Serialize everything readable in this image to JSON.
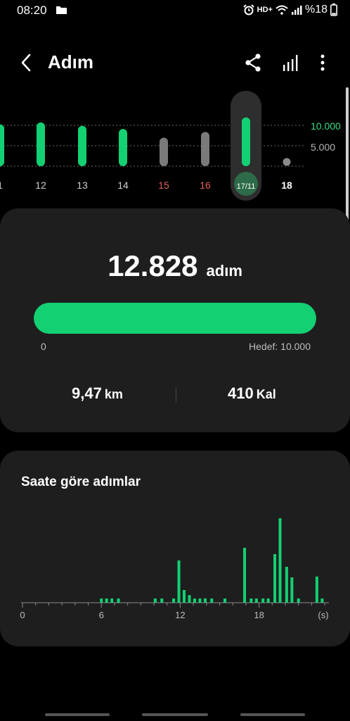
{
  "status_bar": {
    "time": "08:20",
    "network": "HD+",
    "battery": "%18",
    "icons": [
      "folder-icon",
      "alarm-icon",
      "wifi-icon",
      "signal-icon"
    ]
  },
  "app_bar": {
    "title": "Adım",
    "icons": [
      "back-arrow-icon",
      "share-icon",
      "trend-bars-icon",
      "more-vert-icon"
    ]
  },
  "daily_chart": {
    "goal_10k_label": "10.000",
    "goal_5k_label": "5.000",
    "days": [
      {
        "label": "1",
        "steps": 11000,
        "weekend": false,
        "met_goal": true
      },
      {
        "label": "12",
        "steps": 11500,
        "weekend": false,
        "met_goal": true
      },
      {
        "label": "13",
        "steps": 10600,
        "weekend": false,
        "met_goal": true
      },
      {
        "label": "14",
        "steps": 9800,
        "weekend": false,
        "met_goal": true
      },
      {
        "label": "15",
        "steps": 7500,
        "weekend": true,
        "met_goal": false
      },
      {
        "label": "16",
        "steps": 9000,
        "weekend": true,
        "met_goal": false
      },
      {
        "label": "17/11",
        "steps": 12828,
        "weekend": false,
        "met_goal": true,
        "selected": true
      },
      {
        "label": "18",
        "steps": 0,
        "weekend": false,
        "met_goal": false,
        "today": true
      }
    ],
    "colors": {
      "goal": "#13d073",
      "below_goal": "#7a7a7a",
      "weekend_label": "#e0635b"
    }
  },
  "summary": {
    "steps_value": "12.828",
    "steps_unit": "adım",
    "progress_fraction": 1.0,
    "progress_min_label": "0",
    "progress_goal_label": "Hedef: 10.000",
    "distance_value": "9,47",
    "distance_unit": "km",
    "calories_value": "410",
    "calories_unit": "Kal"
  },
  "hourly": {
    "title": "Saate göre adımlar",
    "x_ticks": [
      "0",
      "6",
      "12",
      "18"
    ],
    "unit": "(s)",
    "max_steps": 2000,
    "bars": [
      {
        "hour": 6,
        "steps": 100
      },
      {
        "hour": 6.4,
        "steps": 100
      },
      {
        "hour": 6.8,
        "steps": 100
      },
      {
        "hour": 7.3,
        "steps": 100
      },
      {
        "hour": 10.1,
        "steps": 100
      },
      {
        "hour": 10.6,
        "steps": 100
      },
      {
        "hour": 11.5,
        "steps": 100
      },
      {
        "hour": 11.9,
        "steps": 1000
      },
      {
        "hour": 12.3,
        "steps": 300
      },
      {
        "hour": 12.7,
        "steps": 180
      },
      {
        "hour": 13.1,
        "steps": 100
      },
      {
        "hour": 13.5,
        "steps": 100
      },
      {
        "hour": 13.9,
        "steps": 100
      },
      {
        "hour": 14.4,
        "steps": 100
      },
      {
        "hour": 15.4,
        "steps": 100
      },
      {
        "hour": 16.9,
        "steps": 1300
      },
      {
        "hour": 17.4,
        "steps": 100
      },
      {
        "hour": 17.8,
        "steps": 100
      },
      {
        "hour": 18.3,
        "steps": 100
      },
      {
        "hour": 18.7,
        "steps": 100
      },
      {
        "hour": 19.2,
        "steps": 1150
      },
      {
        "hour": 19.6,
        "steps": 2000
      },
      {
        "hour": 20.1,
        "steps": 850
      },
      {
        "hour": 20.5,
        "steps": 600
      },
      {
        "hour": 21,
        "steps": 100
      },
      {
        "hour": 22.4,
        "steps": 620
      },
      {
        "hour": 22.8,
        "steps": 100
      }
    ]
  }
}
